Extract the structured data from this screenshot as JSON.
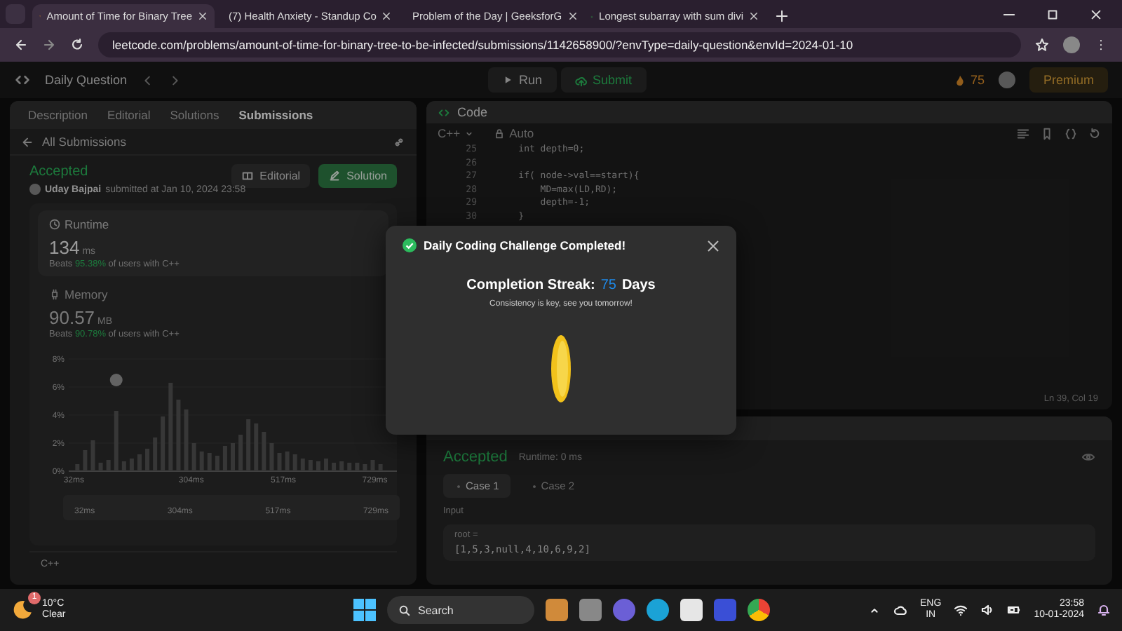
{
  "browser": {
    "tabs": [
      {
        "title": "Amount of Time for Binary Tree",
        "kind": "leetcode",
        "selected": true
      },
      {
        "title": "(7) Health Anxiety - Standup Co",
        "kind": "youtube",
        "selected": false
      },
      {
        "title": "Problem of the Day | GeeksforG",
        "kind": "gfg",
        "selected": false
      },
      {
        "title": "Longest subarray with sum divi",
        "kind": "gfg",
        "selected": false
      }
    ],
    "url": "leetcode.com/problems/amount-of-time-for-binary-tree-to-be-infected/submissions/1142658900/?envType=daily-question&envId=2024-01-10"
  },
  "nav": {
    "title": "Daily Question",
    "run": "Run",
    "submit": "Submit",
    "streak": "75",
    "premium": "Premium"
  },
  "left": {
    "tabs": [
      {
        "label": "Description",
        "selected": false
      },
      {
        "label": "Editorial",
        "selected": false
      },
      {
        "label": "Solutions",
        "selected": false
      },
      {
        "label": "Submissions",
        "selected": true
      }
    ],
    "back": "All Submissions",
    "status": "Accepted",
    "user": "Uday Bajpai",
    "submitted": "submitted at Jan 10, 2024 23:58",
    "buttons": [
      {
        "label": "Editorial",
        "kind": "plain"
      },
      {
        "label": "Solution",
        "kind": "primary"
      }
    ],
    "stats": [
      {
        "kind": "runtime",
        "title": "Runtime",
        "value": "134",
        "unit": "ms",
        "beats": "Beats",
        "percent": "95.38%",
        "rest": "of users with C++",
        "selected": true
      },
      {
        "kind": "memory",
        "title": "Memory",
        "value": "90.57",
        "unit": "MB",
        "beats": "Beats",
        "percent": "90.78%",
        "rest": "of users with C++",
        "selected": false
      }
    ],
    "chart_data": {
      "type": "bar",
      "x": [
        40,
        58,
        76,
        94,
        112,
        130,
        148,
        166,
        184,
        202,
        220,
        238,
        256,
        274,
        292,
        310,
        328,
        346,
        364,
        382,
        400,
        418,
        436,
        454,
        472,
        490,
        508,
        526,
        544,
        562,
        580,
        598,
        616,
        634,
        652,
        670,
        688,
        706,
        724,
        742
      ],
      "values": [
        0.5,
        1.5,
        2.2,
        0.6,
        0.8,
        4.3,
        0.7,
        0.9,
        1.2,
        1.6,
        2.4,
        3.9,
        6.3,
        5.1,
        4.4,
        2.0,
        1.4,
        1.3,
        1.1,
        1.8,
        2.0,
        2.6,
        3.7,
        3.4,
        2.8,
        2.0,
        1.3,
        1.4,
        1.2,
        0.9,
        0.8,
        0.7,
        0.9,
        0.6,
        0.7,
        0.6,
        0.6,
        0.5,
        0.8,
        0.5
      ],
      "xlim": [
        20,
        780
      ],
      "ylim": [
        0,
        8
      ],
      "yticks": [
        {
          "value": 0,
          "label": "0%"
        },
        {
          "value": 2,
          "label": "2%"
        },
        {
          "value": 4,
          "label": "4%"
        },
        {
          "value": 6,
          "label": "6%"
        },
        {
          "value": 8,
          "label": "8%"
        }
      ],
      "xticks": [
        {
          "value": 32,
          "label": "32ms"
        },
        {
          "value": 304,
          "label": "304ms"
        },
        {
          "value": 517,
          "label": "517ms"
        },
        {
          "value": 729,
          "label": "729ms"
        }
      ]
    },
    "range_labels": [
      "32ms",
      "304ms",
      "517ms",
      "729ms"
    ],
    "language": "C++"
  },
  "code": {
    "title": "Code",
    "language": "C++",
    "mode": "Auto",
    "lines": [
      {
        "n": "25",
        "text": "    int depth=0;"
      },
      {
        "n": "26"
      },
      {
        "n": "27",
        "text": "    if( node->val==start){"
      },
      {
        "n": "28",
        "text": "        MD=max(LD,RD);"
      },
      {
        "n": "29",
        "text": "        depth=-1;"
      },
      {
        "n": "30",
        "text": "    }"
      }
    ],
    "position": "Ln 39, Col 19"
  },
  "result": {
    "status": "Accepted",
    "runtime": "Runtime: 0 ms",
    "cases": [
      {
        "label": "Case 1",
        "selected": true
      },
      {
        "label": "Case 2",
        "selected": false
      }
    ],
    "input_label": "Input",
    "var": "root =",
    "value": "[1,5,3,null,4,10,6,9,2]"
  },
  "modal": {
    "title": "Daily Coding Challenge Completed!",
    "streak_label": "Completion Streak:",
    "streak": "75",
    "days": "Days",
    "message": "Consistency is key, see you tomorrow!"
  },
  "taskbar": {
    "temp": "10°C",
    "weather": "Clear",
    "badge": "1",
    "search": "Search",
    "lang": "ENG",
    "region": "IN",
    "time": "23:58",
    "date": "10-01-2024"
  }
}
